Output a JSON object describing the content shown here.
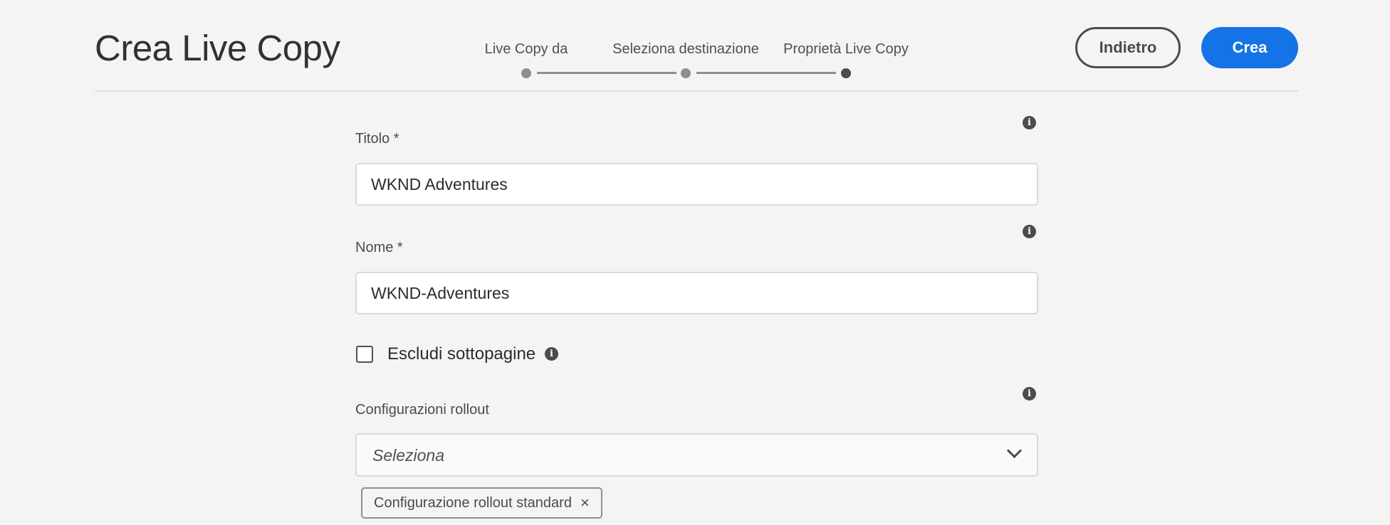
{
  "header": {
    "title": "Crea Live Copy",
    "back_label": "Indietro",
    "create_label": "Crea"
  },
  "steps": [
    {
      "label": "Live Copy da",
      "state": "completed"
    },
    {
      "label": "Seleziona destinazione",
      "state": "completed"
    },
    {
      "label": "Proprietà Live Copy",
      "state": "current"
    }
  ],
  "form": {
    "title_label": "Titolo *",
    "title_value": "WKND Adventures",
    "name_label": "Nome *",
    "name_value": "WKND-Adventures",
    "exclude_subpages_label": "Escludi sottopagine",
    "exclude_subpages_checked": false,
    "rollout_label": "Configurazioni rollout",
    "rollout_placeholder": "Seleziona",
    "rollout_tags": [
      "Configurazione rollout standard"
    ],
    "tag_remove_glyph": "×",
    "info_glyph": "i"
  },
  "colors": {
    "accent": "#1473e6",
    "background": "#f4f4f4"
  }
}
